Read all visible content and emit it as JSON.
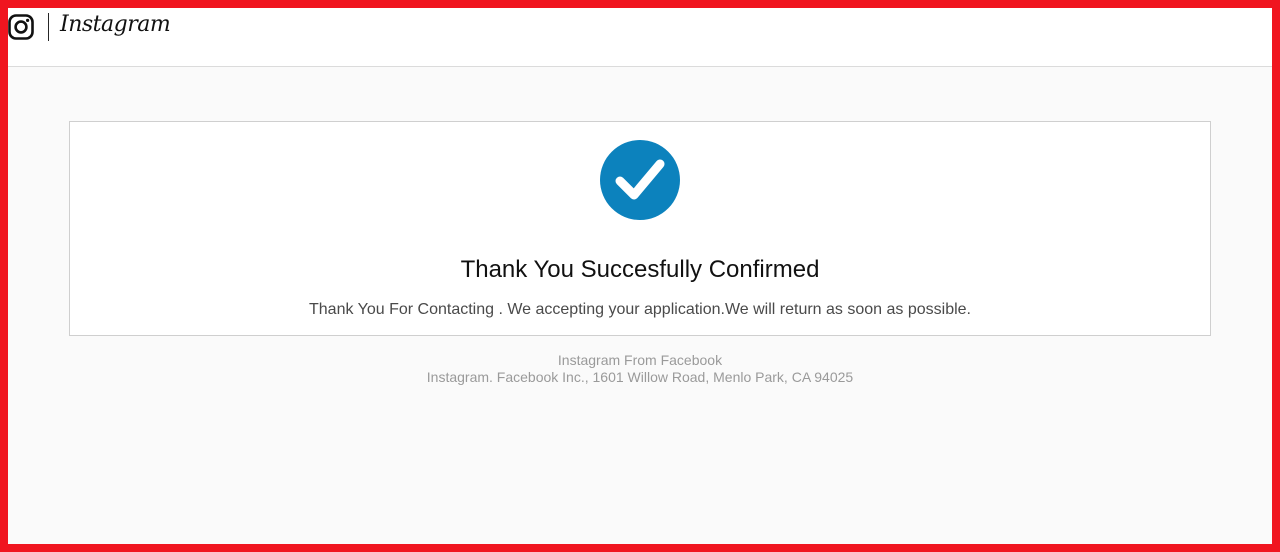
{
  "header": {
    "logo_icon": "instagram-glyph-icon",
    "wordmark": "Instagram"
  },
  "confirmation": {
    "icon": "checkmark-circle-icon",
    "icon_color": "#0c82bd",
    "title": "Thank You Succesfully Confirmed",
    "message": "Thank You For Contacting . We accepting your application.We will return as soon as possible."
  },
  "footer": {
    "line1": "Instagram From Facebook",
    "line2": "Instagram. Facebook Inc., 1601 Willow Road, Menlo Park, CA 94025"
  },
  "colors": {
    "frame": "#f0151f",
    "background": "#fafafa"
  }
}
